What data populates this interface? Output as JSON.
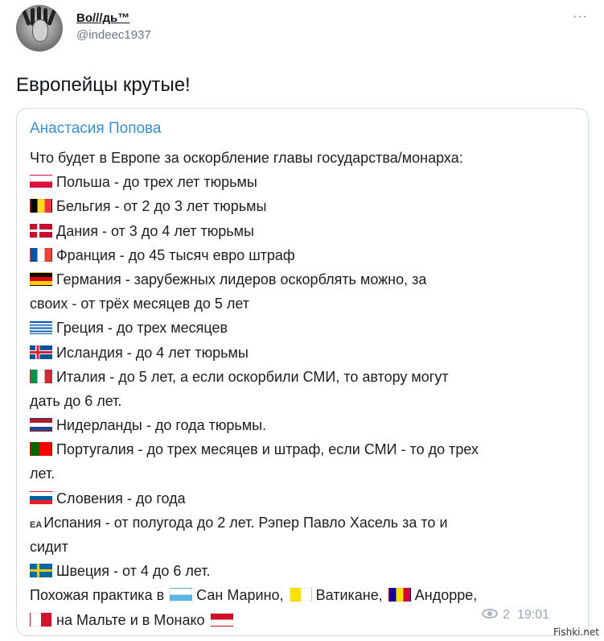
{
  "tweet": {
    "author_name": "Во///дь™",
    "author_handle": "@indeec1937",
    "more_label": "···",
    "text": "Европейцы крутые!"
  },
  "quote": {
    "author": "Анастасия Попова",
    "lines": [
      {
        "flag": "",
        "text": "Что будет в Европе за оскорбление главы государства/монарха:"
      },
      {
        "flag": "poland-flag",
        "text": "Польша - до трех лет тюрьмы"
      },
      {
        "flag": "belgium-flag",
        "text": "Бельгия - от 2 до 3 лет тюрьмы"
      },
      {
        "flag": "denmark-flag",
        "text": "Дания - от 3 до 4 лет тюрьмы"
      },
      {
        "flag": "france-flag",
        "text": "Франция - до 45 тысяч евро штраф"
      },
      {
        "flag": "germany-flag",
        "text": "Германия - зарубежных лидеров оскорблять можно, за"
      },
      {
        "flag": "",
        "text": "своих - от трёх месяцев до 5 лет"
      },
      {
        "flag": "greece-flag",
        "text": "Греция - до трех месяцев"
      },
      {
        "flag": "iceland-flag",
        "text": "Исландия - до 4 лет тюрьмы"
      },
      {
        "flag": "italy-flag",
        "text": "Италия - до 5 лет, а если оскорбили СМИ, то автору могут"
      },
      {
        "flag": "",
        "text": "дать до 6 лет."
      },
      {
        "flag": "netherlands-flag",
        "text": "Нидерланды - до года тюрьмы."
      },
      {
        "flag": "portugal-flag",
        "text": "Португалия - до трех месяцев и штраф, если СМИ - то до трех"
      },
      {
        "flag": "",
        "text": "лет."
      },
      {
        "flag": "slovenia-flag",
        "text": "Словения - до года"
      },
      {
        "flag": "ea-text",
        "text": "Испания - от полугода до 2 лет. Рэпер Павло Хасель за то и"
      },
      {
        "flag": "",
        "text": "сидит"
      },
      {
        "flag": "sweden-flag",
        "text": "Швеция - от 4 до 6 лет."
      },
      {
        "flag": "",
        "text": "Похожая практика в",
        "extra": [
          {
            "flag": "san-marino-flag",
            "text": "Сан Марино,"
          },
          {
            "flag": "vatican-flag",
            "text": "Ватикане,"
          },
          {
            "flag": "andorra-flag",
            "text": "Андорре,"
          }
        ]
      },
      {
        "flag": "malta-flag",
        "text": "на Мальте и в Монако",
        "extra": [
          {
            "flag": "monaco-flag",
            "text": ""
          }
        ]
      }
    ],
    "ea_label": "EA",
    "views": "2",
    "time": "19:01"
  },
  "watermark": "Fishki.net",
  "colors": {
    "quote_author": "#3a8fcc",
    "border": "#cfd9de",
    "meta": "#9aa7b0"
  }
}
